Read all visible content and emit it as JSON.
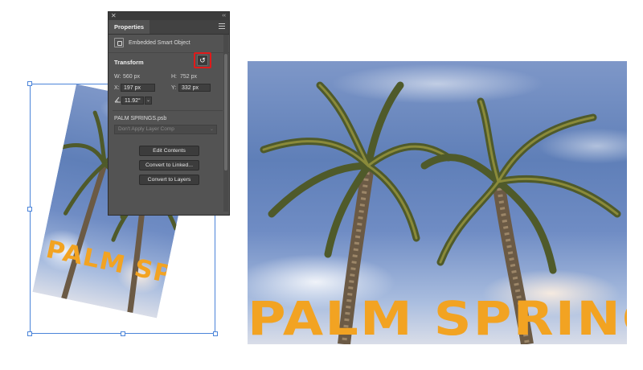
{
  "panel": {
    "close_glyph": "✕",
    "collapse_glyph": "‹‹",
    "tab_label": "Properties",
    "object_type": "Embedded Smart Object",
    "transform": {
      "title": "Transform",
      "w_label": "W:",
      "w_value": "560 px",
      "h_label": "H:",
      "h_value": "752 px",
      "x_label": "X:",
      "x_value": "197 px",
      "y_label": "Y:",
      "y_value": "332 px",
      "angle_value": "11.92°",
      "reset_glyph": "↺"
    },
    "file_name": "PALM SPRINGS.psb",
    "layer_comp_placeholder": "Don't Apply Layer Comp",
    "buttons": {
      "edit": "Edit Contents",
      "convert_linked": "Convert to Linked...",
      "convert_layers": "Convert to Layers"
    }
  },
  "artwork": {
    "title": "PALM SPRINGS",
    "title_color": "#f2a322",
    "highlight_color": "#e11a1a",
    "selection_color": "#4b84d9"
  }
}
